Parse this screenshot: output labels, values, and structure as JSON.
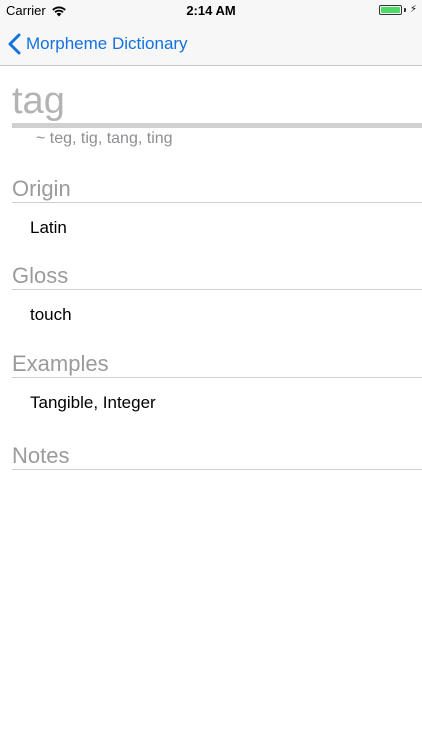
{
  "status_bar": {
    "carrier": "Carrier",
    "time": "2:14 AM",
    "wifi_icon": "wifi-icon",
    "battery_icon": "battery-icon",
    "battery_level": 1.0,
    "battery_color": "#4cd964",
    "charging_icon": "bolt-icon"
  },
  "nav_bar": {
    "back_label": "Morpheme Dictionary",
    "back_icon": "chevron-left-icon",
    "accent_color": "#1272de"
  },
  "morpheme": {
    "title": "tag",
    "variants": "~ teg, tig, tang, ting"
  },
  "sections": {
    "origin": {
      "header": "Origin",
      "value": "Latin"
    },
    "gloss": {
      "header": "Gloss",
      "value": "touch"
    },
    "examples": {
      "header": "Examples",
      "value": "Tangible, Integer"
    },
    "notes": {
      "header": "Notes",
      "value": ""
    }
  }
}
